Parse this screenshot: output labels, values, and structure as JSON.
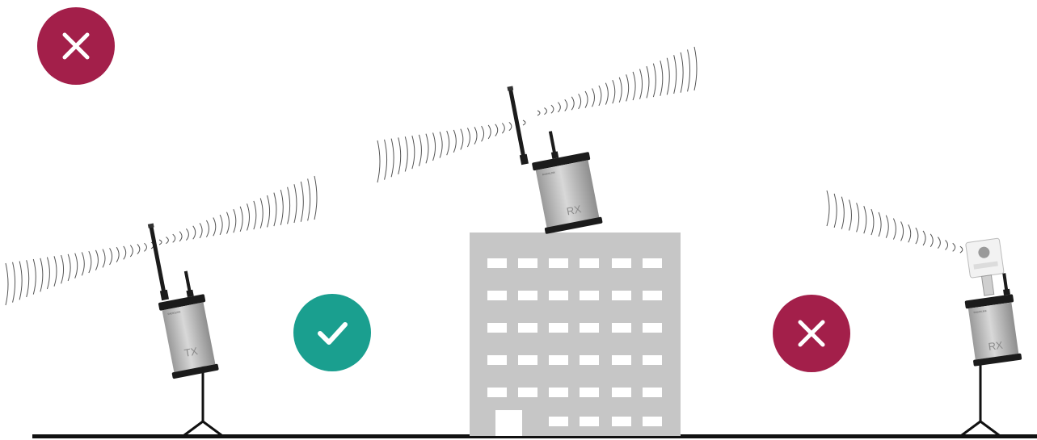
{
  "colors": {
    "fail": "#a31f4a",
    "ok": "#1a9f8f",
    "building": "#c6c6c6",
    "window": "#ffffff",
    "ground": "#111111",
    "device_body": "#b9b9b9",
    "device_dark": "#1b1b1b",
    "signal": "#555555"
  },
  "icons": {
    "top_left": "cross-icon",
    "middle": "check-icon",
    "right": "cross-icon"
  },
  "devices": {
    "left_label": "TX",
    "center_label": "RX",
    "right_label": "RX"
  }
}
